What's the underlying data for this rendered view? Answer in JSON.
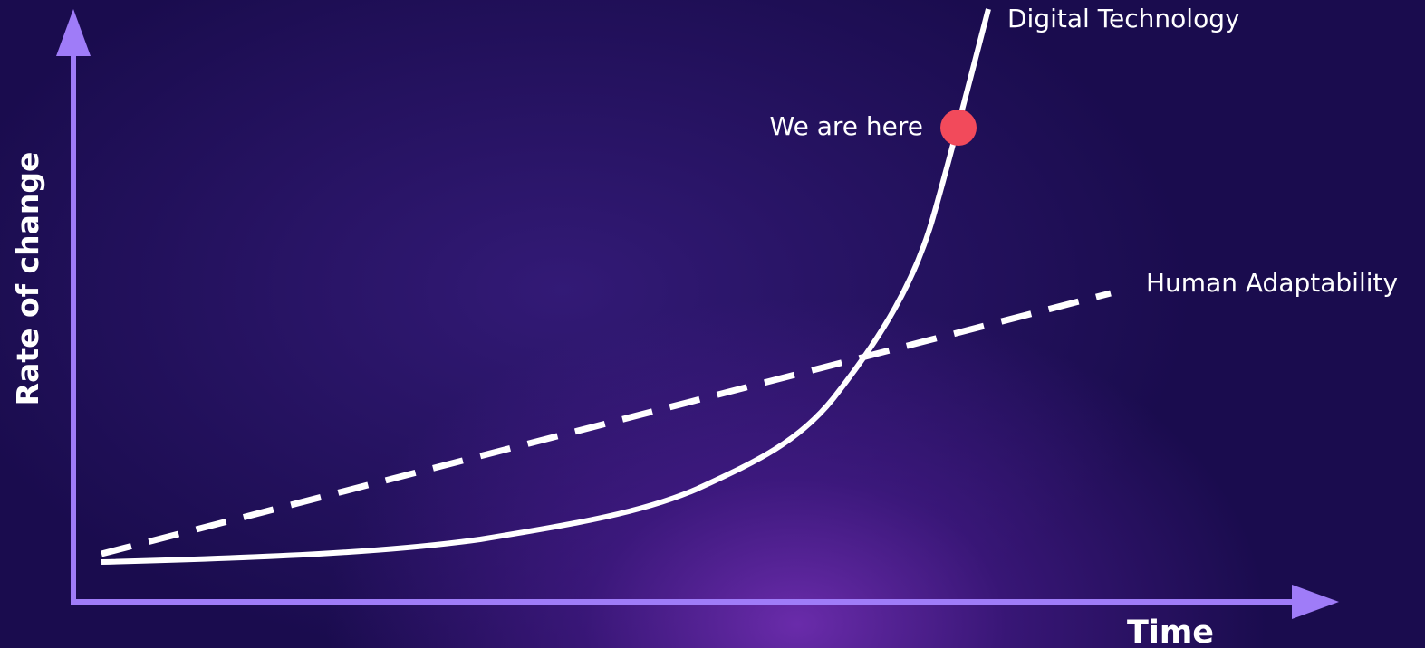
{
  "diagram": {
    "axes": {
      "y_label": "Rate of change",
      "x_label": "Time",
      "color": "#9f7cf8"
    },
    "curves": [
      {
        "name": "Digital Technology",
        "style": "solid",
        "color": "#ffffff"
      },
      {
        "name": "Human Adaptability",
        "style": "dashed",
        "color": "#ffffff"
      }
    ],
    "marker": {
      "label": "We are here",
      "color": "#f24a5b"
    }
  }
}
